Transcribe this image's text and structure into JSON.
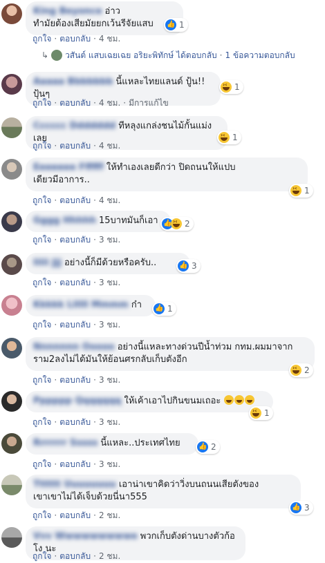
{
  "action_labels": {
    "like": "ถูกใจ",
    "reply": "ตอบกลับ",
    "edited": "มีการแก้ไข"
  },
  "colors": {
    "link": "#385898",
    "bubble": "#f2f3f5",
    "like": "#1877f2",
    "haha": "#f7c633"
  },
  "comments": [
    {
      "name": "King Beyonce",
      "text": "อ่าว\nทำมัยต้องเสียมัยยกเว้นรีจัยแสบ",
      "time": "4 ชม.",
      "reactions": {
        "icons": [
          "like"
        ],
        "count": "1"
      }
    },
    {
      "name": "Aaaaa Bbbbbbb",
      "text": "นี้แหละไทยแลนด์ ปู้น!! ปุ้นๆ",
      "time": "4 ชม.",
      "reactions": {
        "icons": [
          "haha"
        ],
        "count": "1"
      }
    },
    {
      "name": "Cccccc Ddddddd",
      "text": "ทีหลุงแกล่งชนไม้กั้นแม่งเลย",
      "time": "4 ชม.",
      "reactions": {
        "icons": [
          "haha"
        ],
        "count": "1"
      }
    },
    {
      "name": "Eeeeeee Ffffff",
      "text": "ให้ทำเองเลยดีกว่า ปิดถนนให้แปบ\nเดียวมีอาการ..",
      "time": "4 ชม.",
      "reactions": {
        "icons": [
          "haha"
        ],
        "count": "1"
      }
    },
    {
      "name": "Gggg Hhhhh",
      "text": "15บาทมันก็เอา",
      "time": "3 ชม.",
      "reactions": {
        "icons": [
          "like",
          "haha"
        ],
        "count": "2"
      }
    },
    {
      "name": "Iiiii Jjj",
      "text": "อย่างนี้ก็มีด้วยหรือครับ..",
      "time": "3 ชม.",
      "reactions": {
        "icons": [
          "like"
        ],
        "count": "3"
      }
    },
    {
      "name": "Kkkkk Llllll Mmmm",
      "text": "ก๋า",
      "time": "3 ชม.",
      "reactions": {
        "icons": [
          "like"
        ],
        "count": "1"
      }
    },
    {
      "name": "Nnnnnnn Ooooo",
      "text": "อย่างนี้แหละทางด่วนปีน้ำท่วม กทม.ผมมาจาก\nราม2ลงไม่ได้มันให้ย้อนศรกลับเก็บตังอีก",
      "time": "3 ชม.",
      "reactions": {
        "icons": [
          "haha"
        ],
        "count": "2"
      }
    },
    {
      "name": "Pppppp Qqqqqqq",
      "text": "ให้เค้าเอาไปกินขนมเถอะ",
      "emoji_count": 3,
      "time": "3 ชม.",
      "reactions": {
        "icons": [
          "haha"
        ],
        "count": "1"
      }
    },
    {
      "name": "Rrrrrrr Sssss",
      "text": "นี้แหละ..ประเทศไทย",
      "time": "3 ชม.",
      "reactions": {
        "icons": [
          "like"
        ],
        "count": "2"
      }
    },
    {
      "name": "Tttttt Uuuuuuuu",
      "text": "เอาน่าเขาคิดว่าวิ่งบนถนนเสียตังของ\nเขาเขาไม่ได้เจ็บด้วยนี่นา555",
      "time": "2 ชม.",
      "reactions": {
        "icons": [
          "like"
        ],
        "count": "3"
      }
    },
    {
      "name": "Vvv Wwwwwwwwwe",
      "text": "พวกเก็บตังด่านบางตัวก้อ โง นะ",
      "time": "2 ชม.",
      "reactions": null
    }
  ],
  "reply_summary": {
    "arrow": "↳",
    "text": "วสันต์ แสบเฉยเฉย อริยะพิทักษ์ ได้ตอบกลับ",
    "count_text": "1 ข้อความตอบกลับ"
  }
}
